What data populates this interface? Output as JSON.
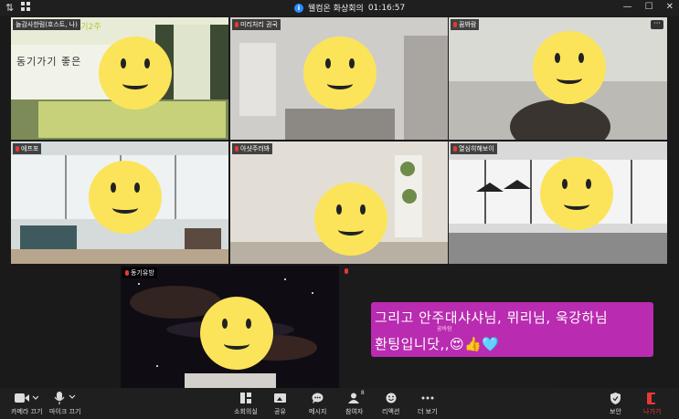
{
  "window": {
    "title": "웰컴온 화상회의",
    "timer": "01:16:57"
  },
  "participants": [
    {
      "name": "놀감사한림(호스트, 나)",
      "slide_line1": "동기가기 좋은",
      "slide_line2": "동기2주"
    },
    {
      "name": "미리처리 권국"
    },
    {
      "name": "꿈봐람"
    },
    {
      "name": "에프포"
    },
    {
      "name": "아샷주러봐"
    },
    {
      "name": "열심히해보이"
    },
    {
      "name": "동기유방"
    },
    {
      "name": ""
    }
  ],
  "caption": {
    "line1": "그리고 안주대샤샤님, 뮈리님, 욱강하님",
    "line2": "환팅입니닷,,😍👍🩵",
    "small_label": "꿈바람"
  },
  "toolbar": {
    "left": [
      {
        "label": "카메라 끄기",
        "icon": "camera-icon"
      },
      {
        "label": "마이크 끄기",
        "icon": "microphone-icon"
      }
    ],
    "center": [
      {
        "label": "소회의실",
        "icon": "breakout-rooms-icon"
      },
      {
        "label": "공유",
        "icon": "share-screen-icon"
      },
      {
        "label": "메시지",
        "icon": "chat-icon"
      },
      {
        "label": "참여자",
        "icon": "participants-icon",
        "badge": "8"
      },
      {
        "label": "리액션",
        "icon": "reactions-icon"
      },
      {
        "label": "더 보기",
        "icon": "more-icon"
      }
    ],
    "right": [
      {
        "label": "보안",
        "icon": "shield-icon"
      },
      {
        "label": "나가기",
        "icon": "leave-icon"
      }
    ]
  },
  "colors": {
    "leave": "#e53935",
    "caption_bg": "#b92bb0",
    "face": "#fbe45a",
    "info": "#2d8cff"
  }
}
